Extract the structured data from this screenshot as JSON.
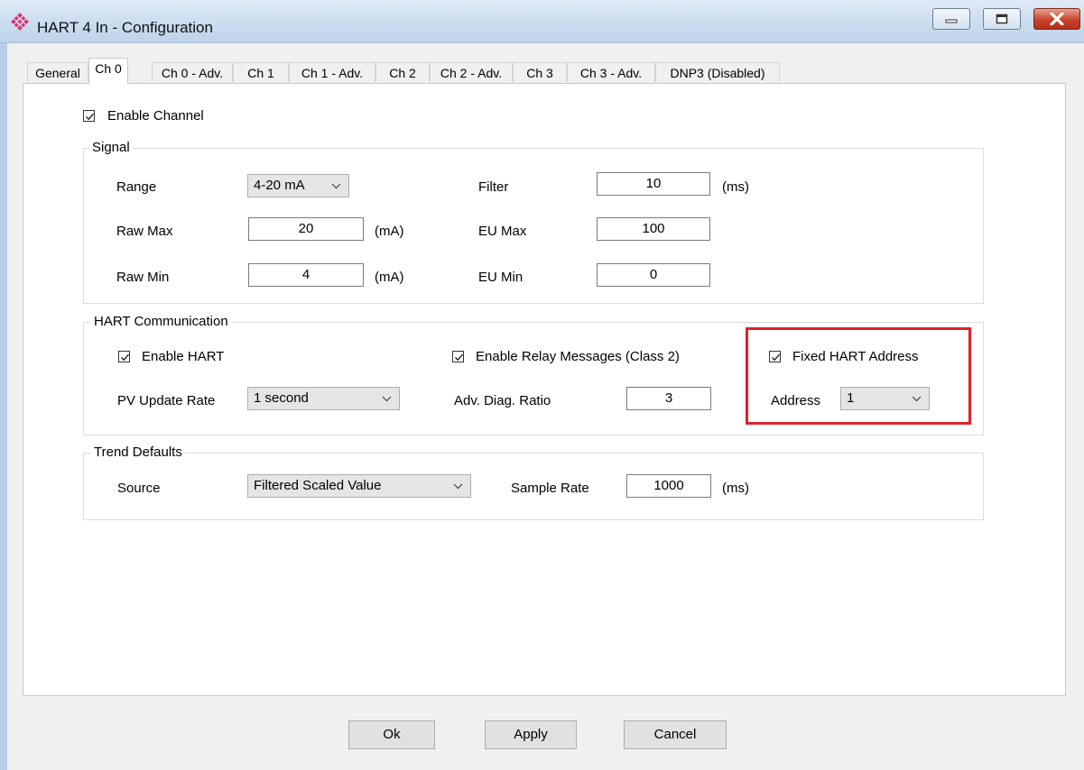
{
  "window": {
    "title": "HART 4 In - Configuration"
  },
  "tabs": [
    "General",
    "Ch 0",
    "Ch 0 - Adv.",
    "Ch 1",
    "Ch 1 - Adv.",
    "Ch 2",
    "Ch 2 - Adv.",
    "Ch 3",
    "Ch 3 - Adv.",
    "DNP3 (Disabled)"
  ],
  "active_tab": "Ch 0",
  "enable_channel": {
    "label": "Enable Channel",
    "checked": true
  },
  "signal": {
    "title": "Signal",
    "range_label": "Range",
    "range_value": "4-20 mA",
    "raw_max_label": "Raw Max",
    "raw_max_value": "20",
    "raw_max_unit": "(mA)",
    "raw_min_label": "Raw Min",
    "raw_min_value": "4",
    "raw_min_unit": "(mA)",
    "filter_label": "Filter",
    "filter_value": "10",
    "filter_unit": "(ms)",
    "eu_max_label": "EU Max",
    "eu_max_value": "100",
    "eu_min_label": "EU Min",
    "eu_min_value": "0"
  },
  "hart": {
    "title": "HART Communication",
    "enable_hart_label": "Enable HART",
    "enable_hart_checked": true,
    "relay_label": "Enable Relay Messages (Class 2)",
    "relay_checked": true,
    "fixed_address_label": "Fixed HART Address",
    "fixed_address_checked": true,
    "pv_rate_label": "PV Update Rate",
    "pv_rate_value": "1 second",
    "diag_ratio_label": "Adv. Diag. Ratio",
    "diag_ratio_value": "3",
    "address_label": "Address",
    "address_value": "1"
  },
  "trend": {
    "title": "Trend Defaults",
    "source_label": "Source",
    "source_value": "Filtered Scaled Value",
    "sample_rate_label": "Sample Rate",
    "sample_rate_value": "1000",
    "sample_rate_unit": "(ms)"
  },
  "buttons": {
    "ok": "Ok",
    "apply": "Apply",
    "cancel": "Cancel"
  },
  "colors": {
    "highlight": "#e0202c",
    "close_button": "#c8432b",
    "app_icon": "#d9346a"
  }
}
